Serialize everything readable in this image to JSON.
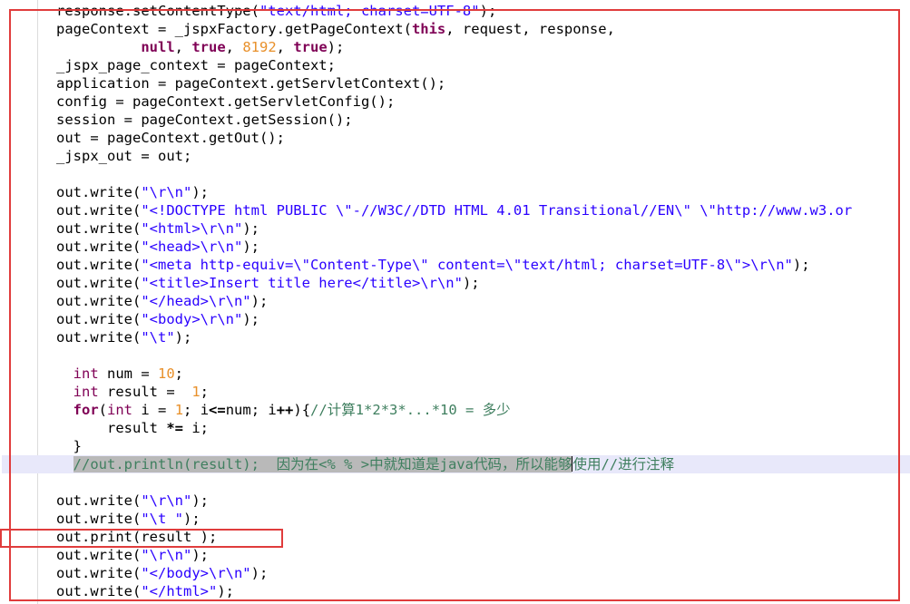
{
  "editor": {
    "lines": [
      {
        "tokens": [
          [
            "response.setContentType(",
            ""
          ],
          [
            "\"text/html; charset=UTF-8\"",
            "str"
          ],
          [
            ");",
            ""
          ]
        ]
      },
      {
        "tokens": [
          [
            "pageContext = _jspxFactory.getPageContext(",
            ""
          ],
          [
            "this",
            "kw"
          ],
          [
            ", request, response,",
            ""
          ]
        ]
      },
      {
        "tokens": [
          [
            "          ",
            ""
          ],
          [
            "null",
            "kw"
          ],
          [
            ", ",
            ""
          ],
          [
            "true",
            "kw"
          ],
          [
            ", ",
            ""
          ],
          [
            "8192",
            "num"
          ],
          [
            ", ",
            ""
          ],
          [
            "true",
            "kw"
          ],
          [
            ");",
            ""
          ]
        ]
      },
      {
        "tokens": [
          [
            "_jspx_page_context = pageContext;",
            ""
          ]
        ]
      },
      {
        "tokens": [
          [
            "application = pageContext.getServletContext();",
            ""
          ]
        ]
      },
      {
        "tokens": [
          [
            "config = pageContext.getServletConfig();",
            ""
          ]
        ]
      },
      {
        "tokens": [
          [
            "session = pageContext.getSession();",
            ""
          ]
        ]
      },
      {
        "tokens": [
          [
            "out = pageContext.getOut();",
            ""
          ]
        ]
      },
      {
        "tokens": [
          [
            "_jspx_out = out;",
            ""
          ]
        ]
      },
      {
        "tokens": []
      },
      {
        "tokens": [
          [
            "out.write(",
            ""
          ],
          [
            "\"\\r\\n\"",
            "str"
          ],
          [
            ");",
            ""
          ]
        ]
      },
      {
        "tokens": [
          [
            "out.write(",
            ""
          ],
          [
            "\"<!DOCTYPE html PUBLIC \\\"-//W3C//DTD HTML 4.01 Transitional//EN\\\" \\\"http://www.w3.or",
            "str"
          ]
        ]
      },
      {
        "tokens": [
          [
            "out.write(",
            ""
          ],
          [
            "\"<html>\\r\\n\"",
            "str"
          ],
          [
            ");",
            ""
          ]
        ]
      },
      {
        "tokens": [
          [
            "out.write(",
            ""
          ],
          [
            "\"<head>\\r\\n\"",
            "str"
          ],
          [
            ");",
            ""
          ]
        ]
      },
      {
        "tokens": [
          [
            "out.write(",
            ""
          ],
          [
            "\"<meta http-equiv=\\\"Content-Type\\\" content=\\\"text/html; charset=UTF-8\\\">\\r\\n\"",
            "str"
          ],
          [
            ");",
            ""
          ]
        ]
      },
      {
        "tokens": [
          [
            "out.write(",
            ""
          ],
          [
            "\"<title>Insert title here</title>\\r\\n\"",
            "str"
          ],
          [
            ");",
            ""
          ]
        ]
      },
      {
        "tokens": [
          [
            "out.write(",
            ""
          ],
          [
            "\"</head>\\r\\n\"",
            "str"
          ],
          [
            ");",
            ""
          ]
        ]
      },
      {
        "tokens": [
          [
            "out.write(",
            ""
          ],
          [
            "\"<body>\\r\\n\"",
            "str"
          ],
          [
            ");",
            ""
          ]
        ]
      },
      {
        "tokens": [
          [
            "out.write(",
            ""
          ],
          [
            "\"\\t\"",
            "str"
          ],
          [
            ");",
            ""
          ]
        ]
      },
      {
        "tokens": []
      },
      {
        "tokens": [
          [
            "  ",
            ""
          ],
          [
            "int",
            "ty"
          ],
          [
            " num = ",
            ""
          ],
          [
            "10",
            "num"
          ],
          [
            ";",
            ""
          ]
        ]
      },
      {
        "tokens": [
          [
            "  ",
            ""
          ],
          [
            "int",
            "ty"
          ],
          [
            " result =  ",
            ""
          ],
          [
            "1",
            "num"
          ],
          [
            ";",
            ""
          ]
        ]
      },
      {
        "tokens": [
          [
            "  ",
            ""
          ],
          [
            "for",
            "kw"
          ],
          [
            "(",
            ""
          ],
          [
            "int",
            "ty"
          ],
          [
            " i = ",
            ""
          ],
          [
            "1",
            "num"
          ],
          [
            "; i",
            ""
          ],
          [
            "<=",
            "op"
          ],
          [
            "num; i",
            ""
          ],
          [
            "++",
            "op"
          ],
          [
            "){",
            ""
          ],
          [
            "//计算1*2*3*...*10 = 多少",
            "cm"
          ]
        ]
      },
      {
        "tokens": [
          [
            "      result ",
            ""
          ],
          [
            "*=",
            "op"
          ],
          [
            " i;",
            ""
          ]
        ]
      },
      {
        "tokens": [
          [
            "  }",
            ""
          ]
        ]
      },
      {
        "tokens": [
          [
            "  ",
            ""
          ],
          [
            "//out.println(result);  因为在<% % >中就知道是java代码，所以能够",
            "cmsel"
          ],
          [
            "",
            "caret"
          ],
          [
            "使用//进行注释",
            "cm"
          ]
        ],
        "current": true
      },
      {
        "tokens": []
      },
      {
        "tokens": [
          [
            "out.write(",
            ""
          ],
          [
            "\"\\r\\n\"",
            "str"
          ],
          [
            ");",
            ""
          ]
        ]
      },
      {
        "tokens": [
          [
            "out.write(",
            ""
          ],
          [
            "\"\\t \"",
            "str"
          ],
          [
            ");",
            ""
          ]
        ]
      },
      {
        "tokens": [
          [
            "out.print(result );",
            ""
          ]
        ]
      },
      {
        "tokens": [
          [
            "out.write(",
            ""
          ],
          [
            "\"\\r\\n\"",
            "str"
          ],
          [
            ");",
            ""
          ]
        ]
      },
      {
        "tokens": [
          [
            "out.write(",
            ""
          ],
          [
            "\"</body>\\r\\n\"",
            "str"
          ],
          [
            ");",
            ""
          ]
        ]
      },
      {
        "tokens": [
          [
            "out.write(",
            ""
          ],
          [
            "\"</html>\"",
            "str"
          ],
          [
            ");",
            ""
          ]
        ]
      }
    ],
    "highlight_colors": {
      "annotation_box": "#e03c3c",
      "current_line": "#e8e8fa",
      "selection": "#b9b9b9"
    }
  }
}
